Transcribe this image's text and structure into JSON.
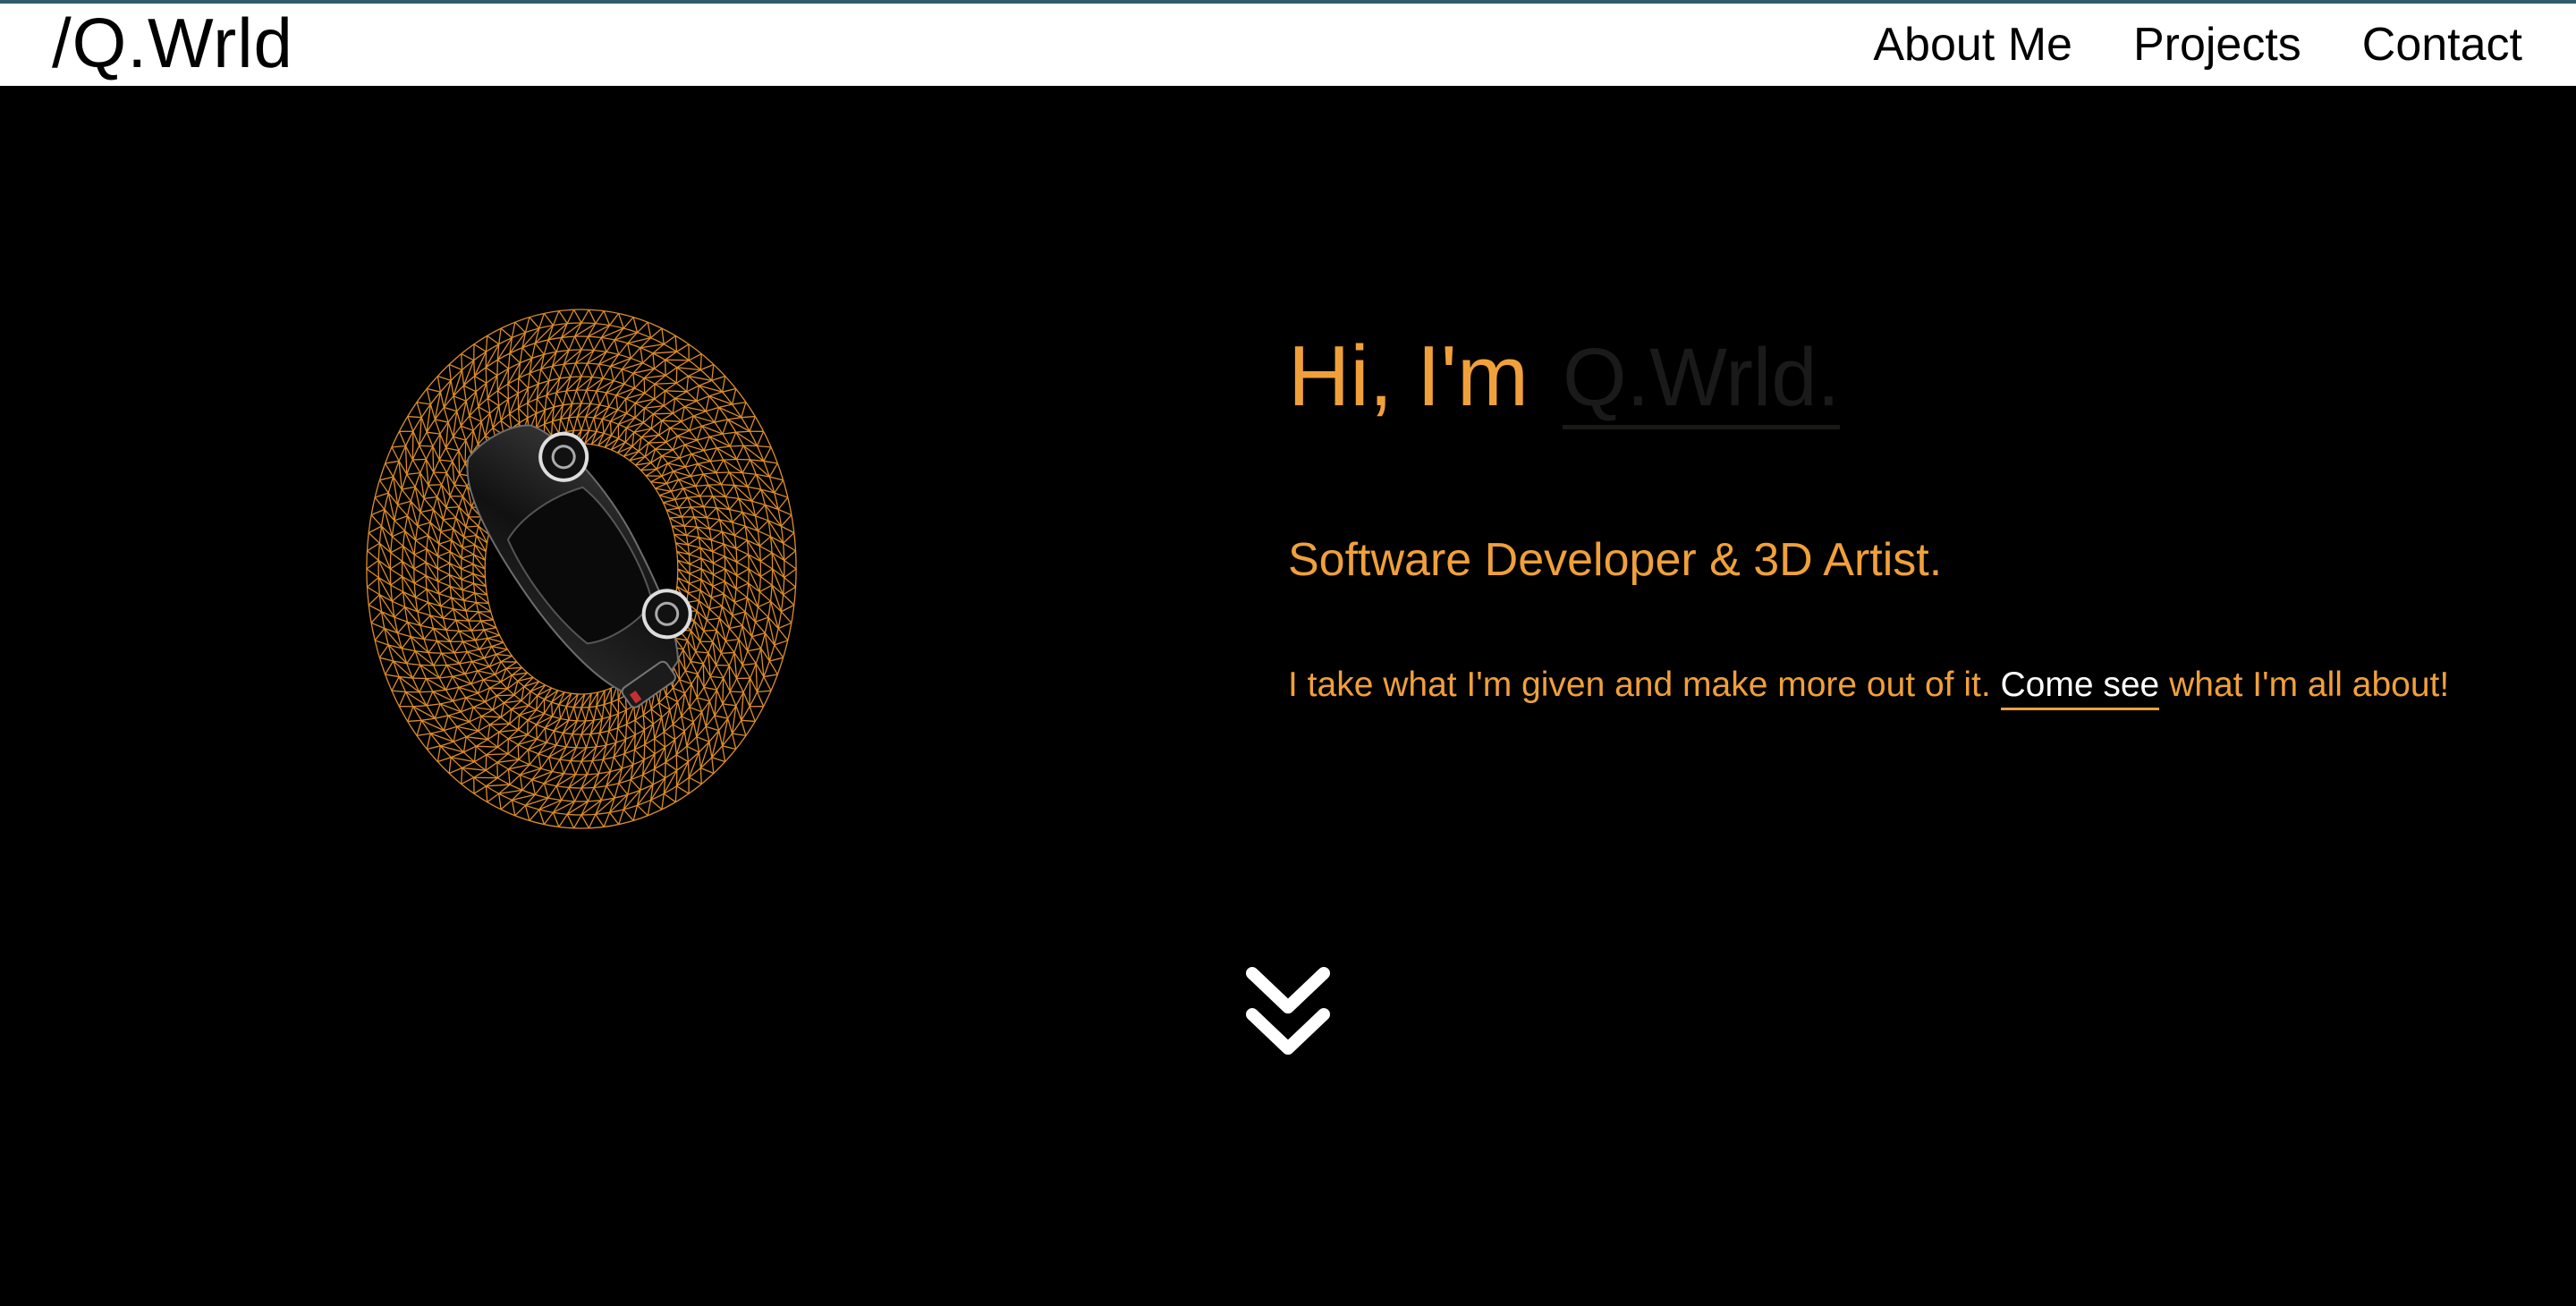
{
  "brand": {
    "title": "/Q.Wrld"
  },
  "nav": {
    "items": [
      {
        "label": "About Me"
      },
      {
        "label": "Projects"
      },
      {
        "label": "Contact"
      }
    ]
  },
  "hero": {
    "greeting": "Hi, I'm",
    "name": "Q.Wrld.",
    "subtitle": "Software Developer & 3D Artist.",
    "tagline_before": "I take what I'm given and make more out of it. ",
    "tagline_link": "Come see",
    "tagline_after": " what I'm all about!",
    "scroll_icon": "double-chevron-down-icon"
  },
  "colors": {
    "accent": "#f0a03a",
    "background": "#000000",
    "navbar": "#ffffff",
    "topline": "#2f5d6e"
  }
}
